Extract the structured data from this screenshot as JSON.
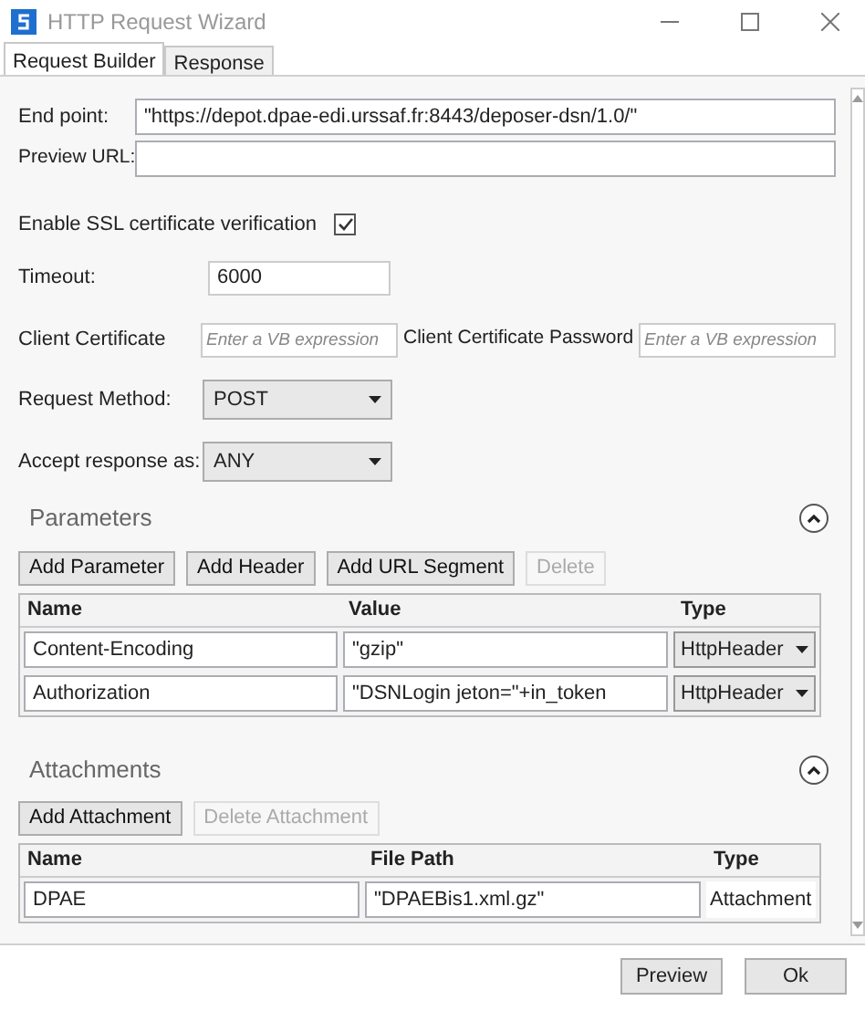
{
  "window": {
    "title": "HTTP Request Wizard"
  },
  "tabs": [
    {
      "label": "Request Builder",
      "selected": true
    },
    {
      "label": "Response",
      "selected": false
    }
  ],
  "endpoint": {
    "label": "End point:",
    "value": "\"https://depot.dpae-edi.urssaf.fr:8443/deposer-dsn/1.0/\""
  },
  "preview_url": {
    "label": "Preview URL:"
  },
  "ssl": {
    "label": "Enable SSL certificate verification",
    "checked": true
  },
  "timeout": {
    "label": "Timeout:",
    "value": "6000"
  },
  "client_certificate": {
    "label": "Client Certificate",
    "placeholder": "Enter a VB expression"
  },
  "client_certificate_password": {
    "label": "Client Certificate Password",
    "placeholder": "Enter a VB expression"
  },
  "request_method": {
    "label": "Request Method:",
    "value": "POST"
  },
  "accept_response": {
    "label": "Accept response as:",
    "value": "ANY"
  },
  "parameters": {
    "title": "Parameters",
    "expanded": true,
    "buttons": [
      {
        "label": "Add Parameter",
        "disabled": false
      },
      {
        "label": "Add Header",
        "disabled": false
      },
      {
        "label": "Add URL Segment",
        "disabled": false
      },
      {
        "label": "Delete",
        "disabled": true
      }
    ],
    "columns": [
      "Name",
      "Value",
      "Type"
    ],
    "rows": [
      {
        "name": "Content-Encoding",
        "value": "\"gzip\"",
        "type": "HttpHeader"
      },
      {
        "name": "Authorization",
        "value": "\"DSNLogin jeton=\"+in_token",
        "type": "HttpHeader"
      }
    ]
  },
  "attachments": {
    "title": "Attachments",
    "expanded": true,
    "buttons": [
      {
        "label": "Add Attachment",
        "disabled": false
      },
      {
        "label": "Delete Attachment",
        "disabled": true
      }
    ],
    "columns": [
      "Name",
      "File Path",
      "Type"
    ],
    "rows": [
      {
        "name": "DPAE",
        "file_path": "\"DPAEBis1.xml.gz\"",
        "type": "Attachment"
      }
    ]
  },
  "footer_buttons": [
    "Preview",
    "Ok"
  ]
}
